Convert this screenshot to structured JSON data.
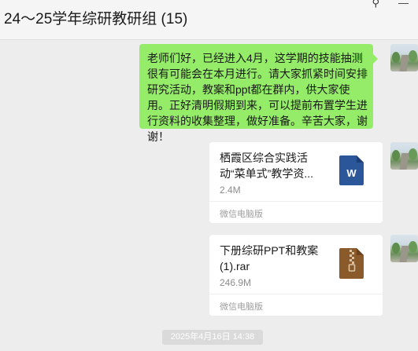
{
  "chat": {
    "title": "24～25学年综研教研组 (15)"
  },
  "window": {
    "pin_icon": "pin-icon",
    "minimize_icon": "minimize-icon",
    "pin_glyph": "⚲",
    "minimize_glyph": "—"
  },
  "messages": {
    "text": "老师们好，已经进入4月，这学期的技能抽测很有可能会在本月进行。请大家抓紧时间安排研究活动，教案和ppt都在群内，供大家使用。正好清明假期到来，可以提前布置学生进行资料的收集整理，做好准备。辛苦大家，谢谢！",
    "file1": {
      "name": "栖霞区综合实践活动“菜单式”教学资...",
      "size": "2.4M",
      "source": "微信电脑版",
      "icon": "word-file-icon",
      "icon_letter": "W"
    },
    "file2": {
      "name": "下册综研PPT和教案(1).rar",
      "size": "246.9M",
      "source": "微信电脑版",
      "icon": "archive-file-icon"
    }
  },
  "timestamp": "2025年4月16日 14:38",
  "colors": {
    "bubble_green": "#95ec69",
    "word_blue": "#2b579a",
    "archive_brown": "#8b5a2b"
  }
}
